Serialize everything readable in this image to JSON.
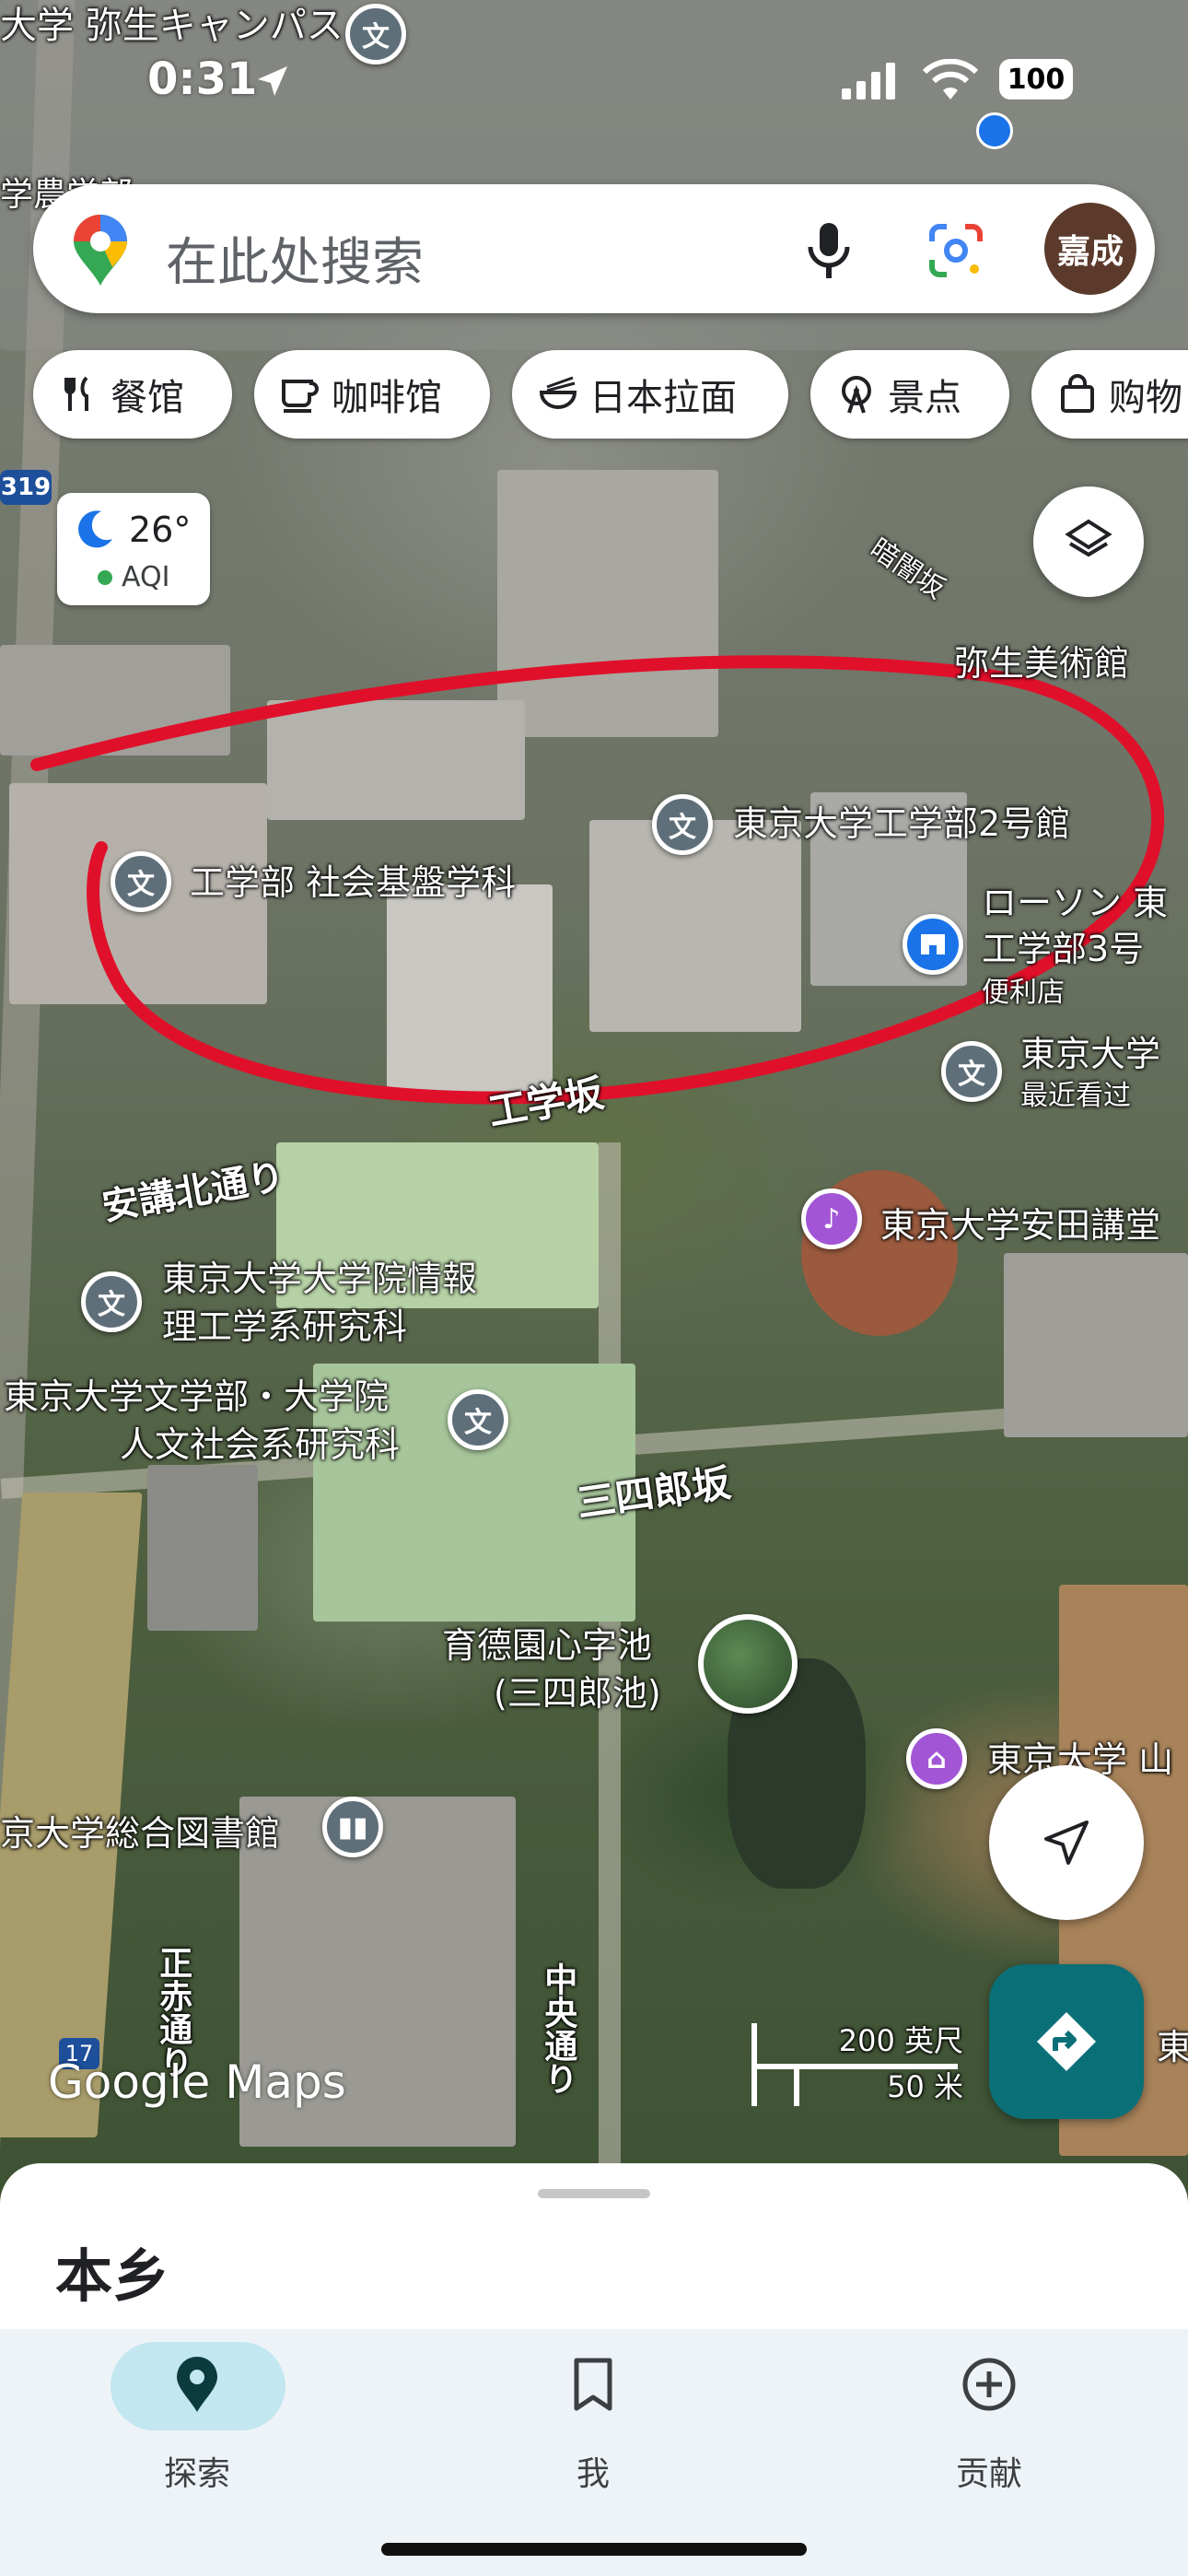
{
  "status_bar": {
    "time": "0:31",
    "battery": "100"
  },
  "search": {
    "placeholder": "在此处搜索",
    "avatar_text": "嘉成"
  },
  "chips": [
    "餐馆",
    "咖啡馆",
    "日本拉面",
    "景点",
    "购物"
  ],
  "weather": {
    "temperature": "26°",
    "aqi": "AQI"
  },
  "route_badge": "319",
  "map_labels": {
    "top_left": "大学 弥生キャンパス",
    "nouhou": "学農学部",
    "kurayami": "暗闇坂",
    "yayoi_museum": "弥生美術館",
    "eng2": "東京大学工学部2号館",
    "lawson_1": "ローソン 東",
    "lawson_2": "工学部3号",
    "lawson_3": "便利店",
    "shakai": "工学部 社会基盤学科",
    "todai_1": "東京大学",
    "todai_2": "最近看过",
    "kougakuzaka": "工学坂",
    "anko": "安講北通り",
    "yasuda": "東京大学安田講堂",
    "joho_1": "東京大学大学院情報",
    "joho_2": "理工学系研究科",
    "bun_1": "東京大学文学部・大学院",
    "bun_2": "人文社会系研究科",
    "sanshiro": "三四郎坂",
    "ike_1": "育德園心字池",
    "ike_2": "(三四郎池)",
    "yama": "東京大学 山",
    "library": "京大学総合図書館",
    "seimon": "正赤通り",
    "chuo": "中央通り",
    "scale_ft": "200 英尺",
    "scale_m": "50 米",
    "badge17": "17",
    "edge_right": "東",
    "logo": "Google Maps"
  },
  "sheet": {
    "title": "本乡"
  },
  "nav": [
    {
      "label": "探索",
      "active": true,
      "icon": "location-pin-icon"
    },
    {
      "label": "我",
      "active": false,
      "icon": "bookmark-icon"
    },
    {
      "label": "贡献",
      "active": false,
      "icon": "add-circle-icon"
    }
  ],
  "colors": {
    "annotation_circle": "#e0102a",
    "directions_fab": "#0a6f77",
    "nav_active": "#c2e7f0"
  }
}
